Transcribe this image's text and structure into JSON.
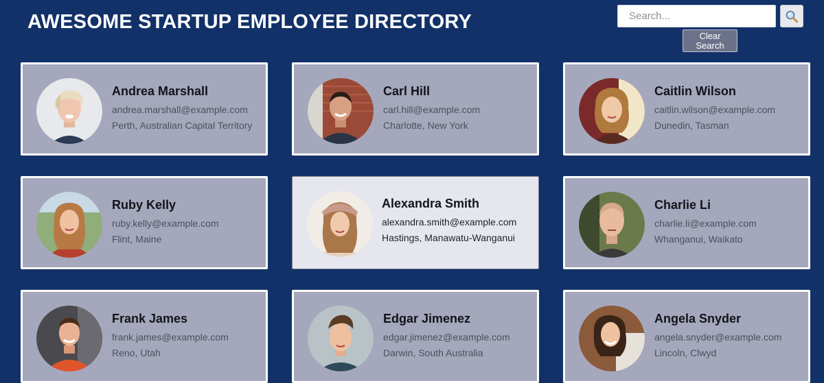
{
  "header": {
    "title": "AWESOME STARTUP EMPLOYEE DIRECTORY"
  },
  "search": {
    "placeholder": "Search...",
    "value": "",
    "button_icon": "magnifier-icon",
    "clear_label": "Clear Search"
  },
  "colors": {
    "page_background": "#123168",
    "card_background": "#a5a8bc",
    "card_highlight_background": "#e6e7ee",
    "card_border": "#ffffff",
    "clear_button": "#6c728a"
  },
  "employees": [
    {
      "name": "Andrea Marshall",
      "email": "andrea.marshall@example.com",
      "location": "Perth, Australian Capital Territory",
      "highlighted": false
    },
    {
      "name": "Carl Hill",
      "email": "carl.hill@example.com",
      "location": "Charlotte, New York",
      "highlighted": false
    },
    {
      "name": "Caitlin Wilson",
      "email": "caitlin.wilson@example.com",
      "location": "Dunedin, Tasman",
      "highlighted": false
    },
    {
      "name": "Ruby Kelly",
      "email": "ruby.kelly@example.com",
      "location": "Flint, Maine",
      "highlighted": false
    },
    {
      "name": "Alexandra Smith",
      "email": "alexandra.smith@example.com",
      "location": "Hastings, Manawatu-Wanganui",
      "highlighted": true
    },
    {
      "name": "Charlie Li",
      "email": "charlie.li@example.com",
      "location": "Whanganui, Waikato",
      "highlighted": false
    },
    {
      "name": "Frank James",
      "email": "frank.james@example.com",
      "location": "Reno, Utah",
      "highlighted": false
    },
    {
      "name": "Edgar Jimenez",
      "email": "edgar.jimenez@example.com",
      "location": "Darwin, South Australia",
      "highlighted": false
    },
    {
      "name": "Angela Snyder",
      "email": "angela.snyder@example.com",
      "location": "Lincoln, Clwyd",
      "highlighted": false
    }
  ]
}
